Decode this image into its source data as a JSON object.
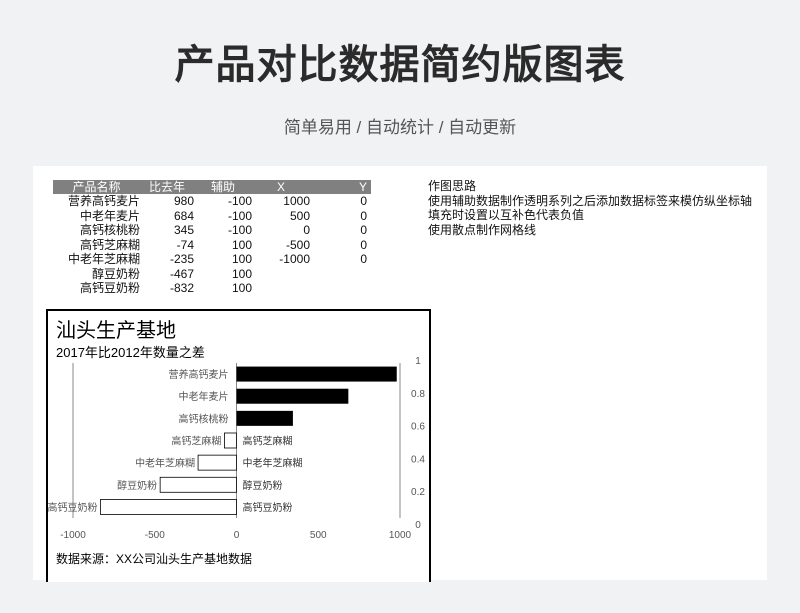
{
  "header": {
    "title": "产品对比数据简约版图表",
    "subtitle": "简单易用 / 自动统计 / 自动更新"
  },
  "table": {
    "headers": [
      "产品名称",
      "比去年",
      "辅助",
      "X",
      "Y"
    ],
    "rows": [
      [
        "营养高钙麦片",
        "980",
        "-100",
        "1000",
        "0"
      ],
      [
        "中老年麦片",
        "684",
        "-100",
        "500",
        "0"
      ],
      [
        "高钙核桃粉",
        "345",
        "-100",
        "0",
        "0"
      ],
      [
        "高钙芝麻糊",
        "-74",
        "100",
        "-500",
        "0"
      ],
      [
        "中老年芝麻糊",
        "-235",
        "100",
        "-1000",
        "0"
      ],
      [
        "醇豆奶粉",
        "-467",
        "100",
        "",
        ""
      ],
      [
        "高钙豆奶粉",
        "-832",
        "100",
        "",
        ""
      ]
    ]
  },
  "notes": {
    "lines": [
      "作图思路",
      "使用辅助数据制作透明系列之后添加数据标签来模仿纵坐标轴",
      "填充时设置以互补色代表负值",
      "使用散点制作网格线"
    ]
  },
  "chart_data": {
    "type": "bar",
    "orientation": "horizontal",
    "title": "汕头生产基地",
    "subtitle": "2017年比2012年数量之差",
    "source": "数据来源：XX公司汕头生产基地数据",
    "categories": [
      "营养高钙麦片",
      "中老年麦片",
      "高钙核桃粉",
      "高钙芝麻糊",
      "中老年芝麻糊",
      "醇豆奶粉",
      "高钙豆奶粉"
    ],
    "values": [
      980,
      684,
      345,
      -74,
      -235,
      -467,
      -832
    ],
    "helper_values": [
      -100,
      -100,
      -100,
      100,
      100,
      100,
      100
    ],
    "x_ticks": [
      "-1000",
      "-500",
      "0",
      "500",
      "1000"
    ],
    "xlim": [
      -1000,
      1000
    ],
    "y2_ticks": [
      "0",
      "0.2",
      "0.4",
      "0.6",
      "0.8",
      "1"
    ],
    "y2lim": [
      0,
      1
    ],
    "gridlines_x": [
      -1000,
      0,
      1000
    ],
    "positive_color": "#000000",
    "negative_color": "#ffffff",
    "grid_color": "#888888"
  }
}
